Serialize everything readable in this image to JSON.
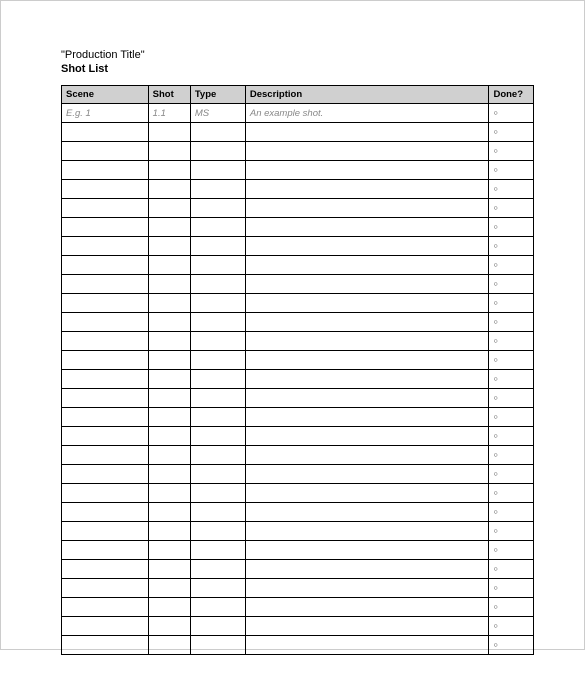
{
  "header": {
    "production_title": "\"Production Title\"",
    "document_title": "Shot List"
  },
  "table": {
    "columns": {
      "scene": "Scene",
      "shot": "Shot",
      "type": "Type",
      "description": "Description",
      "done": "Done?"
    },
    "example_row": {
      "scene": "E.g. 1",
      "shot": "1.1",
      "type": "MS",
      "description": "An example shot.",
      "done_mark": "○"
    },
    "empty_rows": [
      {
        "done_mark": "○"
      },
      {
        "done_mark": "○"
      },
      {
        "done_mark": "○"
      },
      {
        "done_mark": "○"
      },
      {
        "done_mark": "○"
      },
      {
        "done_mark": "○"
      },
      {
        "done_mark": "○"
      },
      {
        "done_mark": "○"
      },
      {
        "done_mark": "○"
      },
      {
        "done_mark": "○"
      },
      {
        "done_mark": "○"
      },
      {
        "done_mark": "○"
      },
      {
        "done_mark": "○"
      },
      {
        "done_mark": "○"
      },
      {
        "done_mark": "○"
      },
      {
        "done_mark": "○"
      },
      {
        "done_mark": "○"
      },
      {
        "done_mark": "○"
      },
      {
        "done_mark": "○"
      },
      {
        "done_mark": "○"
      },
      {
        "done_mark": "○"
      },
      {
        "done_mark": "○"
      },
      {
        "done_mark": "○"
      },
      {
        "done_mark": "○"
      },
      {
        "done_mark": "○"
      },
      {
        "done_mark": "○"
      },
      {
        "done_mark": "○"
      },
      {
        "done_mark": "○"
      }
    ]
  }
}
